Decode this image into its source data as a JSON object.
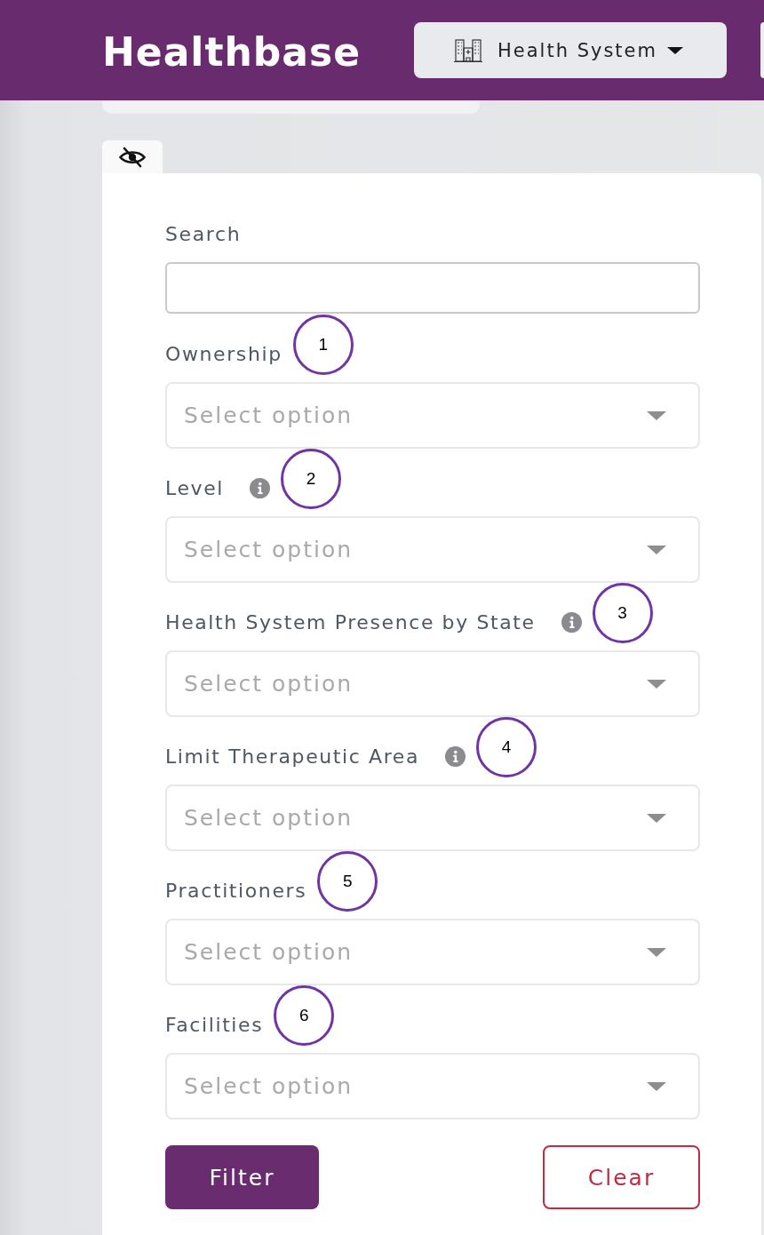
{
  "header": {
    "title": "Healthbase",
    "system_menu": {
      "label": "Health System"
    }
  },
  "panel_toggle": {
    "hidden": true
  },
  "filters": {
    "search": {
      "label": "Search"
    },
    "selects": [
      {
        "label": "Ownership",
        "info_icon": false,
        "placeholder": "Select option",
        "callout": "1"
      },
      {
        "label": "Level",
        "info_icon": true,
        "placeholder": "Select option",
        "callout": "2"
      },
      {
        "label": "Health System Presence by State",
        "info_icon": true,
        "placeholder": "Select option",
        "callout": "3"
      },
      {
        "label": "Limit Therapeutic Area",
        "info_icon": true,
        "placeholder": "Select option",
        "callout": "4"
      },
      {
        "label": "Practitioners",
        "info_icon": false,
        "placeholder": "Select option",
        "callout": "5"
      },
      {
        "label": "Facilities",
        "info_icon": false,
        "placeholder": "Select option",
        "callout": "6"
      }
    ]
  },
  "buttons": [
    {
      "label": "Filter",
      "kind": "primary"
    },
    {
      "label": "Clear",
      "kind": "outline"
    }
  ]
}
